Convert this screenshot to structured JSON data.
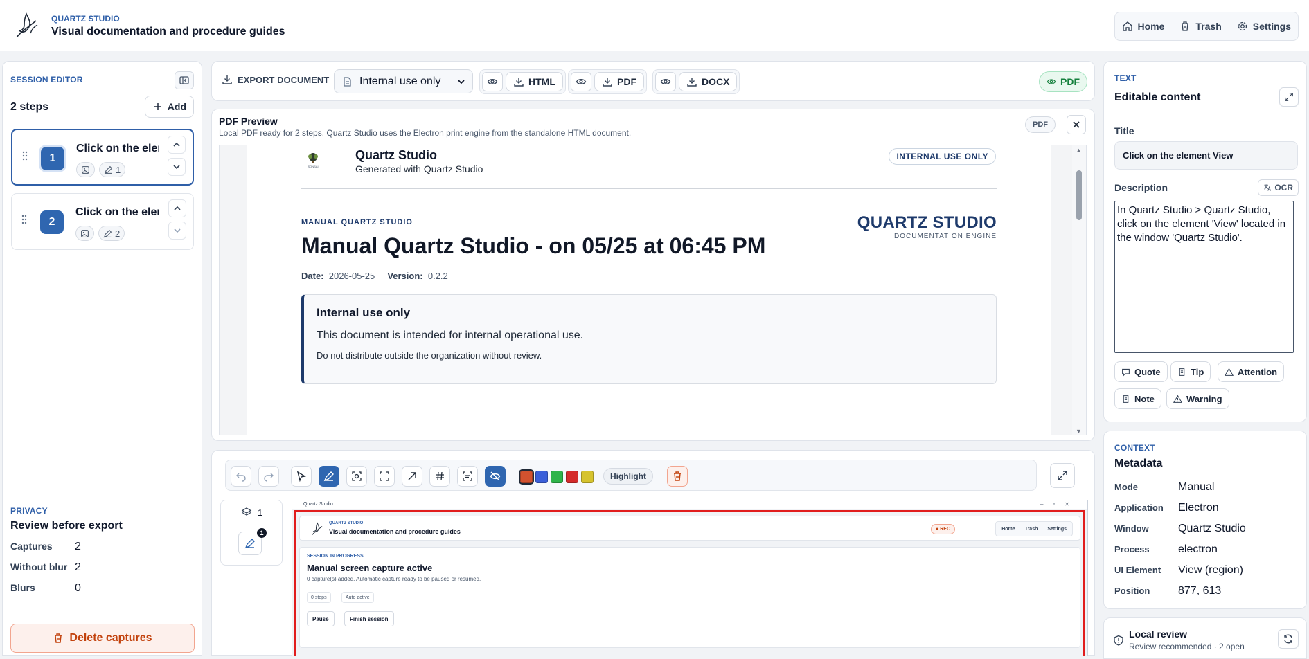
{
  "header": {
    "brand": "QUARTZ STUDIO",
    "subtitle": "Visual documentation and procedure guides",
    "nav": [
      {
        "label": "Home",
        "icon": "home-icon"
      },
      {
        "label": "Trash",
        "icon": "trash-icon"
      },
      {
        "label": "Settings",
        "icon": "gear-icon"
      }
    ]
  },
  "sidebar": {
    "title": "SESSION EDITOR",
    "step_count": "2 steps",
    "add_label": "Add",
    "steps": [
      {
        "number": "1",
        "title": "Click on the element View",
        "annotations": "1"
      },
      {
        "number": "2",
        "title": "Click on the element View",
        "annotations": "2"
      }
    ],
    "privacy": {
      "label": "PRIVACY",
      "title": "Review before export",
      "rows": [
        {
          "key": "Captures",
          "value": "2"
        },
        {
          "key": "Without blur",
          "value": "2"
        },
        {
          "key": "Blurs",
          "value": "0"
        }
      ]
    },
    "delete_label": "Delete captures"
  },
  "export_bar": {
    "export_label": "EXPORT DOCUMENT",
    "classification": "Internal use only",
    "formats": [
      "HTML",
      "PDF",
      "DOCX"
    ],
    "active_badge": "PDF"
  },
  "preview": {
    "title": "PDF Preview",
    "subtitle": "Local PDF ready for 2 steps. Quartz Studio uses the Electron print engine from the standalone HTML document.",
    "badge": "PDF",
    "doc": {
      "logo_text": "SONSAI",
      "name": "Quartz Studio",
      "generated": "Generated with Quartz Studio",
      "classification": "INTERNAL USE ONLY",
      "kicker": "MANUAL QUARTZ STUDIO",
      "heading": "Manual Quartz Studio - on 05/25 at 06:45 PM",
      "date_label": "Date:",
      "date": "2026-05-25",
      "version_label": "Version:",
      "version": "0.2.2",
      "brand_main": "QUARTZ STUDIO",
      "brand_sub": "DOCUMENTATION ENGINE",
      "notice_title": "Internal use only",
      "notice_body": "This document is intended for internal operational use.",
      "notice_small": "Do not distribute outside the organization without review."
    }
  },
  "editor": {
    "highlight_label": "Highlight",
    "colors": [
      "#d2522f",
      "#3b5fd9",
      "#2fb44a",
      "#d42b2b",
      "#d6c32e"
    ],
    "layer_count": "1",
    "badge_count": "1",
    "capture": {
      "window_title": "Quartz Studio",
      "brand": "QUARTZ STUDIO",
      "subtitle": "Visual documentation and procedure guides",
      "rec": "● REC",
      "nav": [
        "Home",
        "Trash",
        "Settings"
      ],
      "kicker": "SESSION IN PROGRESS",
      "title": "Manual screen capture active",
      "desc": "0 capture(s) added. Automatic capture ready to be paused or resumed.",
      "chips": [
        "0 steps",
        "Auto active"
      ],
      "buttons": [
        "Pause",
        "Finish session"
      ]
    }
  },
  "text_panel": {
    "label": "TEXT",
    "title": "Editable content",
    "title_label": "Title",
    "title_value": "Click on the element View",
    "description_label": "Description",
    "ocr_label": "OCR",
    "description": "In Quartz Studio > Quartz Studio, click on the element 'View' located in the window 'Quartz Studio'.",
    "formats": [
      "Quote",
      "Tip",
      "Attention",
      "Note",
      "Warning"
    ]
  },
  "context_panel": {
    "label": "CONTEXT",
    "title": "Metadata",
    "rows": [
      {
        "key": "Mode",
        "value": "Manual"
      },
      {
        "key": "Application",
        "value": "Electron"
      },
      {
        "key": "Window",
        "value": "Quartz Studio"
      },
      {
        "key": "Process",
        "value": "electron"
      },
      {
        "key": "UI Element",
        "value": "View (region)"
      },
      {
        "key": "Position",
        "value": "877, 613"
      }
    ]
  },
  "local_review": {
    "title": "Local review",
    "subtitle": "Review recommended · 2 open"
  }
}
